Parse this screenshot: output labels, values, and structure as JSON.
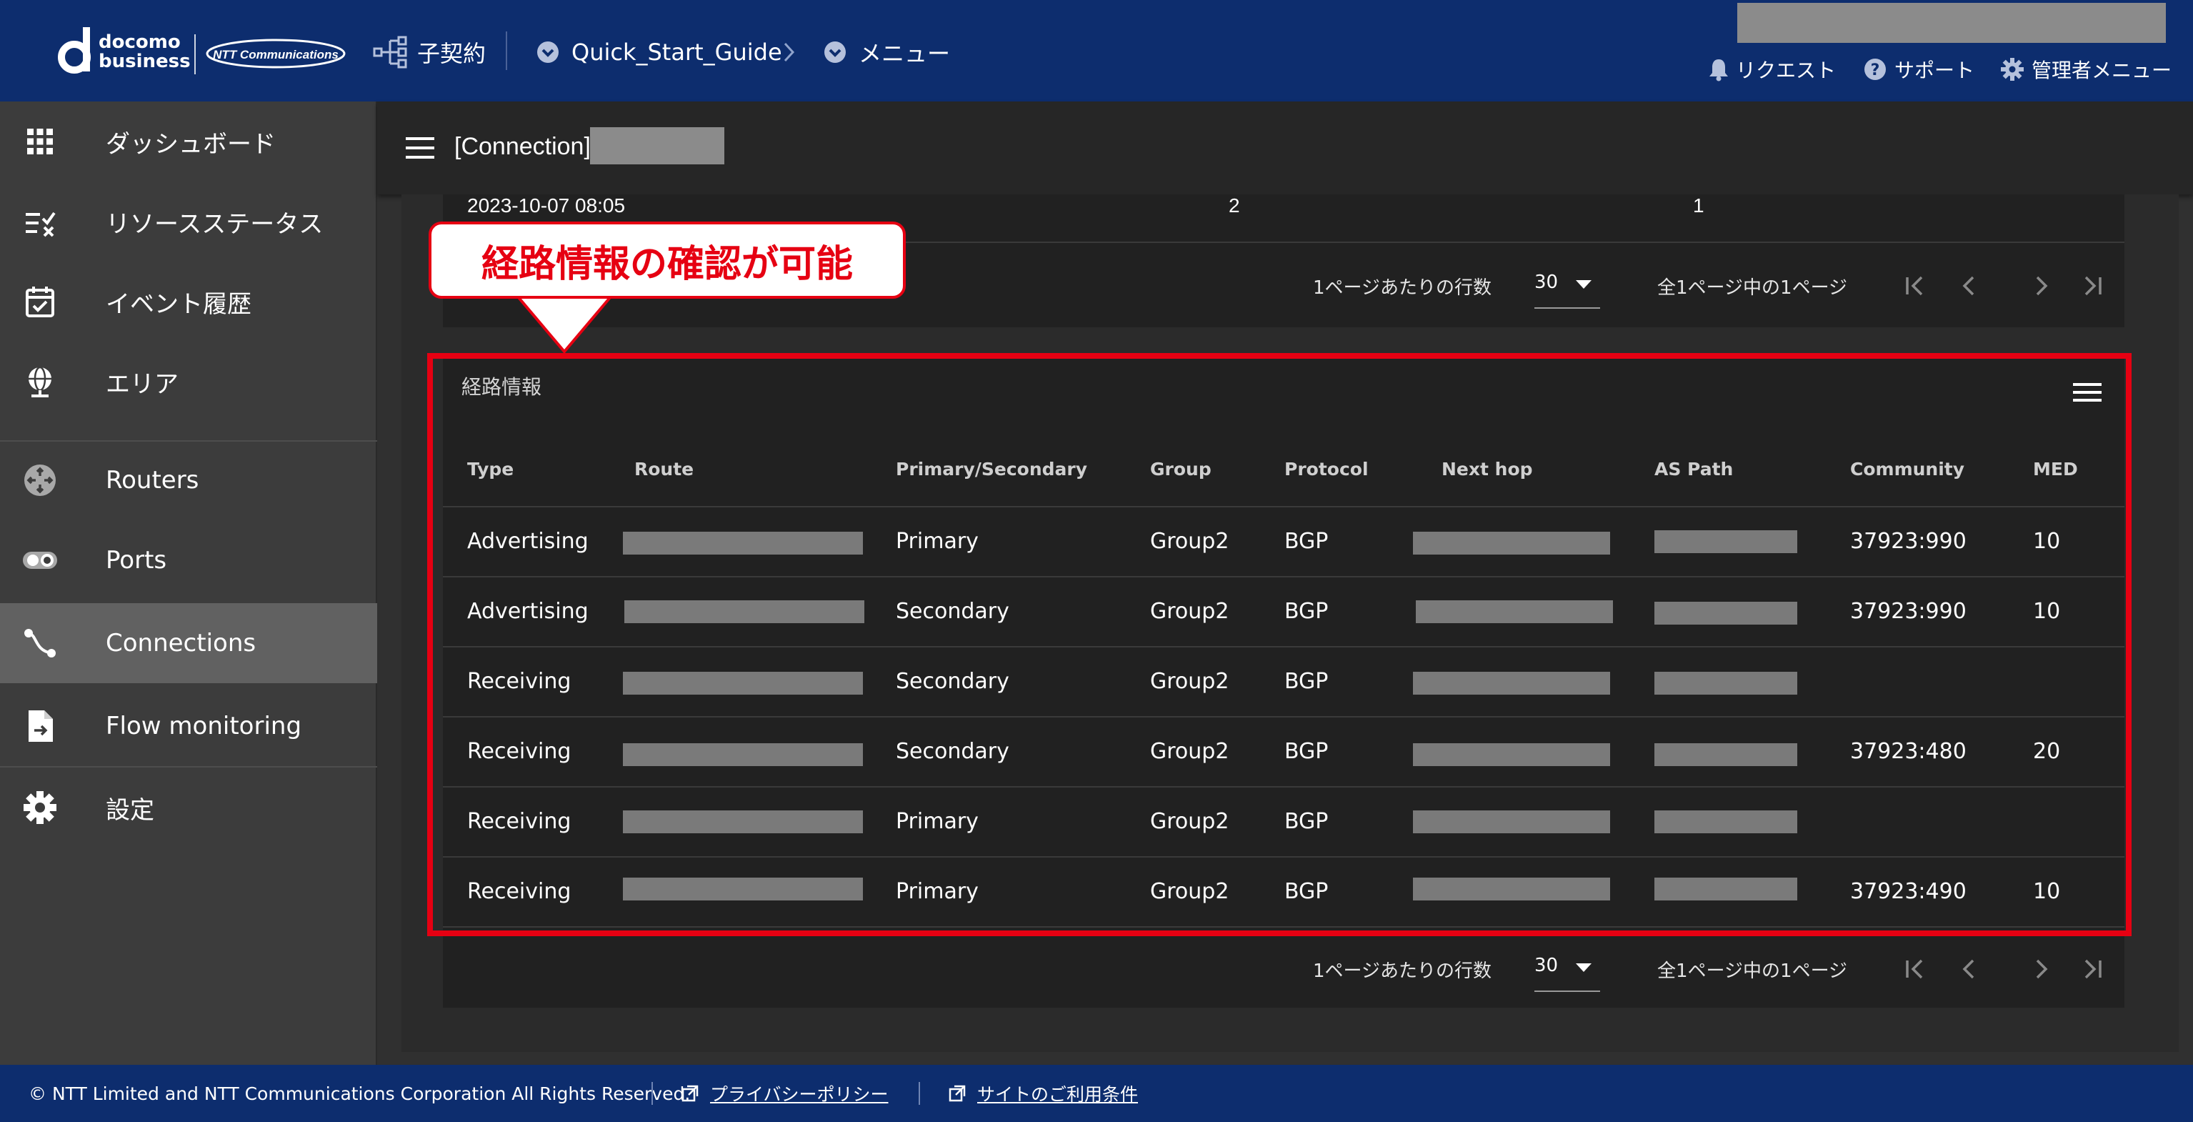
{
  "header": {
    "brand_line1": "docomo",
    "brand_line2": "business",
    "ntt_logo_text": "NTT Communications",
    "contract_label": "子契約",
    "breadcrumb_1": "Quick_Start_Guide",
    "breadcrumb_2": "メニュー",
    "request_label": "リクエスト",
    "support_label": "サポート",
    "admin_label": "管理者メニュー"
  },
  "sidebar": {
    "items": [
      {
        "label": "ダッシュボード",
        "icon": "grid-icon"
      },
      {
        "label": "リソースステータス",
        "icon": "checklist-icon"
      },
      {
        "label": "イベント履歴",
        "icon": "calendar-icon"
      },
      {
        "label": "エリア",
        "icon": "globe-icon"
      },
      {
        "label": "Routers",
        "icon": "router-icon"
      },
      {
        "label": "Ports",
        "icon": "port-icon"
      },
      {
        "label": "Connections",
        "icon": "connection-icon"
      },
      {
        "label": "Flow monitoring",
        "icon": "file-icon"
      },
      {
        "label": "設定",
        "icon": "gear-icon"
      }
    ],
    "active": "Connections"
  },
  "page": {
    "title": "[Connection]"
  },
  "top_table": {
    "row": {
      "date": "2023-10-07 08:05",
      "col2": "2",
      "col3": "1"
    }
  },
  "pagination": {
    "rows_per_page_label": "1ページあたりの行数",
    "rows_per_page_value": "30",
    "page_info": "全1ページ中の1ページ"
  },
  "routes": {
    "title": "経路情報",
    "columns": [
      "Type",
      "Route",
      "Primary/Secondary",
      "Group",
      "Protocol",
      "Next hop",
      "AS Path",
      "Community",
      "MED"
    ],
    "rows": [
      {
        "type": "Advertising",
        "ps": "Primary",
        "group": "Group2",
        "protocol": "BGP",
        "community": "37923:990",
        "med": "10"
      },
      {
        "type": "Advertising",
        "ps": "Secondary",
        "group": "Group2",
        "protocol": "BGP",
        "community": "37923:990",
        "med": "10"
      },
      {
        "type": "Receiving",
        "ps": "Secondary",
        "group": "Group2",
        "protocol": "BGP",
        "community": "",
        "med": ""
      },
      {
        "type": "Receiving",
        "ps": "Secondary",
        "group": "Group2",
        "protocol": "BGP",
        "community": "37923:480",
        "med": "20"
      },
      {
        "type": "Receiving",
        "ps": "Primary",
        "group": "Group2",
        "protocol": "BGP",
        "community": "",
        "med": ""
      },
      {
        "type": "Receiving",
        "ps": "Primary",
        "group": "Group2",
        "protocol": "BGP",
        "community": "37923:490",
        "med": "10"
      }
    ]
  },
  "annotation": {
    "callout_text": "経路情報の確認が可能",
    "color": "#e60012"
  },
  "footer": {
    "copyright": "© NTT Limited and NTT Communications Corporation All Rights Reserved.",
    "privacy_label": "プライバシーポリシー",
    "terms_label": "サイトのご利用条件"
  },
  "colors": {
    "header_bg": "#0d2d6e",
    "sidebar_bg": "#3c3c3c",
    "sidebar_active": "#616161",
    "content_bg": "#2b2b2b",
    "card_bg": "#212121"
  }
}
